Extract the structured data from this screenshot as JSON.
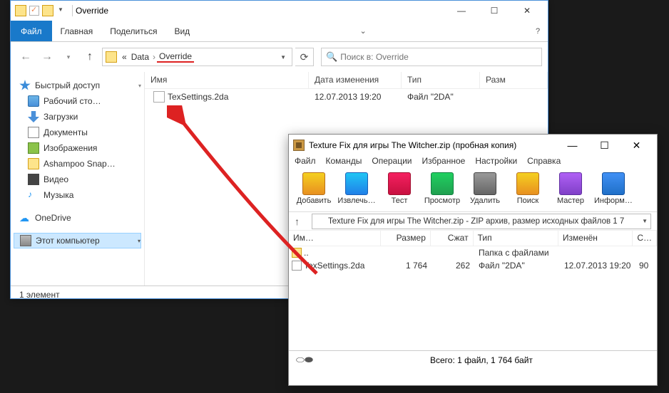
{
  "explorer": {
    "title": "Override",
    "ribbon": {
      "file": "Файл",
      "tabs": [
        "Главная",
        "Поделиться",
        "Вид"
      ]
    },
    "nav": {
      "crumbs": [
        "«",
        "Data",
        "Override"
      ],
      "search_placeholder": "Поиск в: Override"
    },
    "sidebar": {
      "quick": "Быстрый доступ",
      "items": [
        {
          "label": "Рабочий сто…"
        },
        {
          "label": "Загрузки"
        },
        {
          "label": "Документы"
        },
        {
          "label": "Изображения"
        },
        {
          "label": "Ashampoo Snap…"
        },
        {
          "label": "Видео"
        },
        {
          "label": "Музыка"
        }
      ],
      "onedrive": "OneDrive",
      "thispc": "Этот компьютер"
    },
    "columns": {
      "name": "Имя",
      "date": "Дата изменения",
      "type": "Тип",
      "size": "Разм"
    },
    "rows": [
      {
        "name": "TexSettings.2da",
        "date": "12.07.2013 19:20",
        "type": "Файл \"2DA\""
      }
    ],
    "status": "1 элемент"
  },
  "winrar": {
    "title": "Texture Fix для игры The Witcher.zip (пробная копия)",
    "menu": [
      "Файл",
      "Команды",
      "Операции",
      "Избранное",
      "Настройки",
      "Справка"
    ],
    "toolbar": [
      {
        "label": "Добавить"
      },
      {
        "label": "Извлечь…"
      },
      {
        "label": "Тест"
      },
      {
        "label": "Просмотр"
      },
      {
        "label": "Удалить"
      },
      {
        "label": "Поиск"
      },
      {
        "label": "Мастер"
      },
      {
        "label": "Информаци…"
      }
    ],
    "addr": "Texture Fix для игры The Witcher.zip - ZIP архив, размер исходных файлов 1 7",
    "columns": {
      "name": "Им…",
      "size": "Размер",
      "packed": "Сжат",
      "type": "Тип",
      "modified": "Изменён",
      "crc": "C…"
    },
    "rows": [
      {
        "name": "..",
        "size": "",
        "packed": "",
        "type": "Папка с файлами",
        "modified": "",
        "crc": ""
      },
      {
        "name": "TexSettings.2da",
        "size": "1 764",
        "packed": "262",
        "type": "Файл \"2DA\"",
        "modified": "12.07.2013 19:20",
        "crc": "90"
      }
    ],
    "status": "Всего: 1 файл, 1 764 байт"
  }
}
